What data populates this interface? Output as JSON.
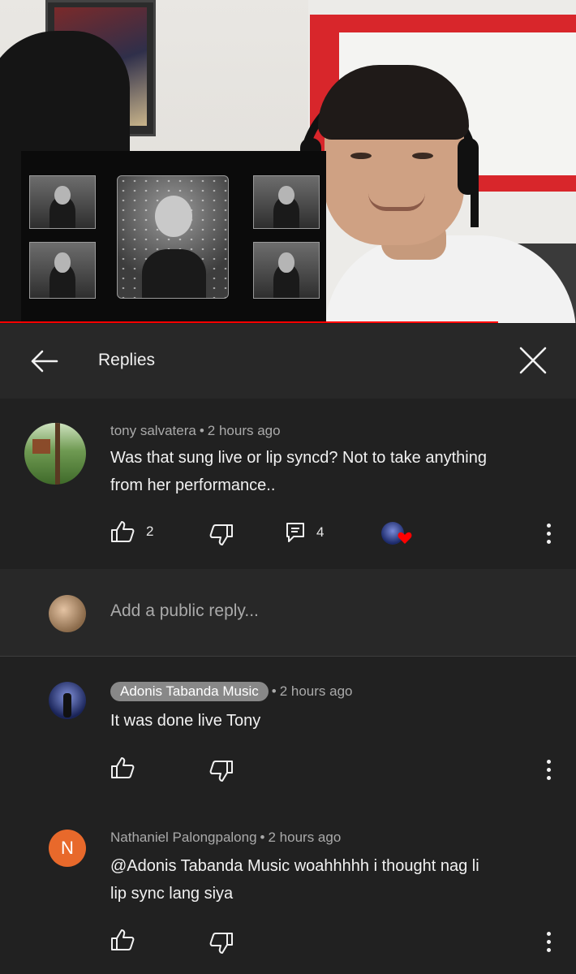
{
  "header": {
    "title": "Replies"
  },
  "main_comment": {
    "author": "tony salvatera",
    "time": "2 hours ago",
    "text_line1": "Was that sung live or lip syncd? Not to take anything",
    "text_line2": "from her  performance..",
    "likes": "2",
    "replies": "4"
  },
  "reply_input": {
    "placeholder": "Add a public reply..."
  },
  "replies": [
    {
      "author": "Adonis Tabanda Music",
      "time": "2 hours ago",
      "text": "It was done live Tony"
    },
    {
      "author": "Nathaniel Palongpalong",
      "avatar_letter": "N",
      "time": "2 hours ago",
      "text_line1": "@Adonis Tabanda Music woahhhhh i thought nag li",
      "text_line2": "lip sync lang siya"
    }
  ],
  "colors": {
    "background": "#212121",
    "header": "#282828",
    "progress": "#ff0000",
    "heart": "#ff0000",
    "avatar_n": "#e8692b"
  },
  "icons": [
    "back-arrow-icon",
    "close-icon",
    "thumbs-up-icon",
    "thumbs-down-icon",
    "reply-icon",
    "heart-icon",
    "more-vert-icon"
  ]
}
